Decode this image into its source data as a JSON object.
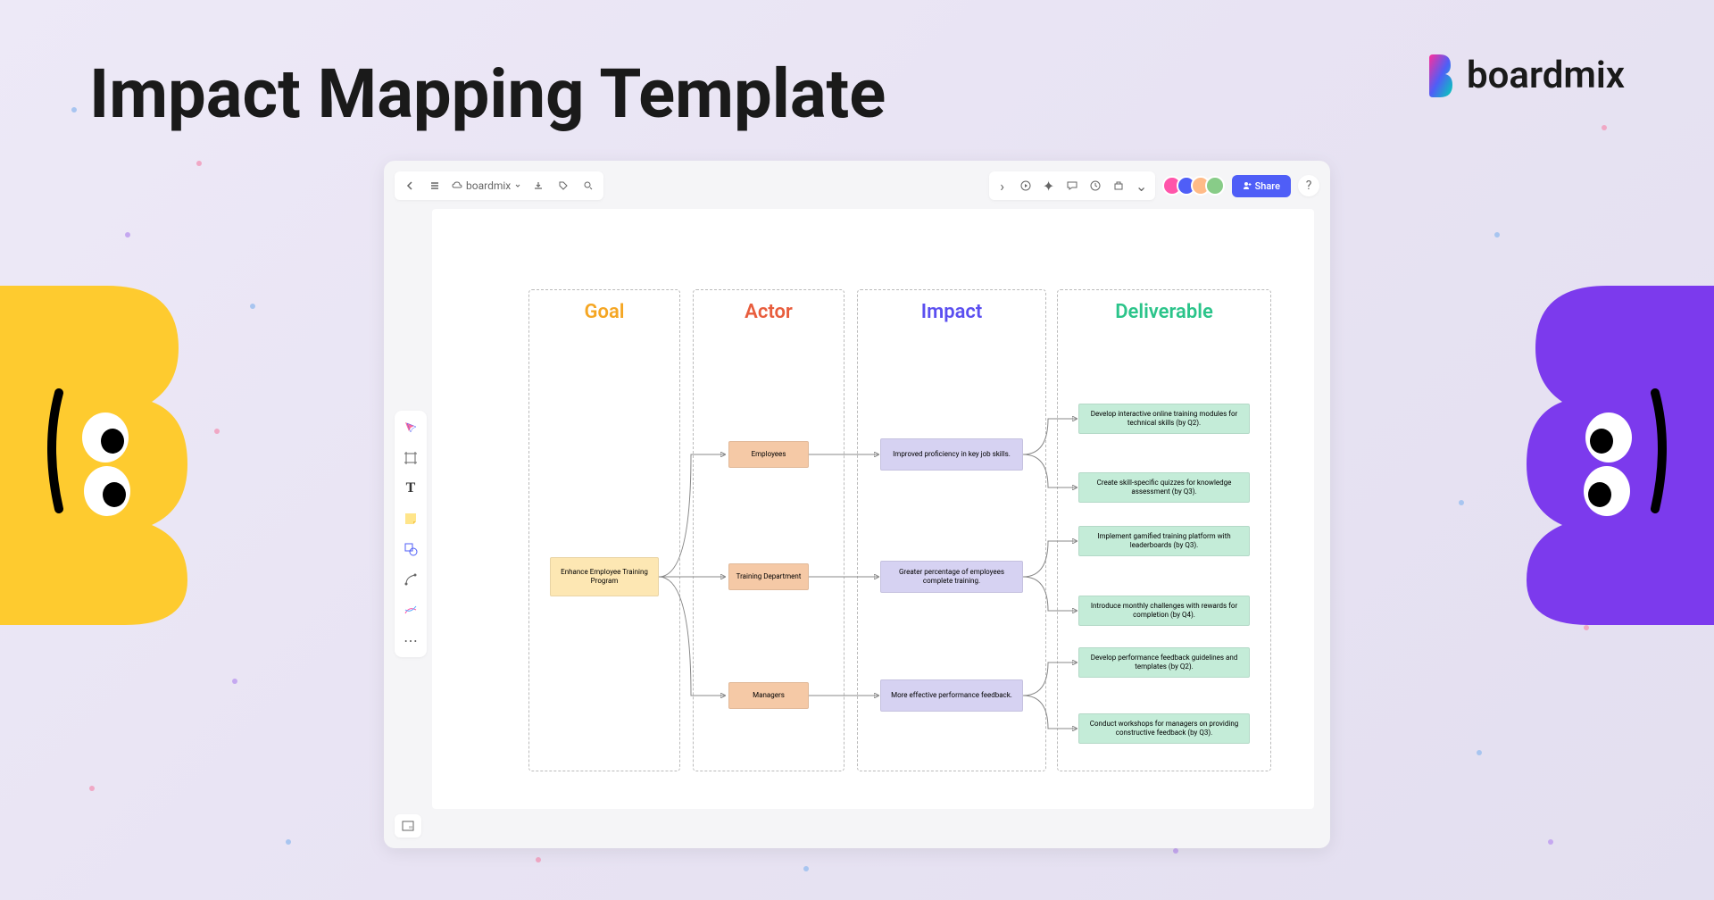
{
  "hero": {
    "title": "Impact Mapping Template"
  },
  "brand": {
    "name": "boardmix"
  },
  "app": {
    "toolbar": {
      "file_name": "boardmix",
      "share_label": "Share"
    },
    "columns": {
      "goal": "Goal",
      "actor": "Actor",
      "impact": "Impact",
      "deliverable": "Deliverable"
    },
    "nodes": {
      "goal": "Enhance Employee Training Program",
      "actors": [
        "Employees",
        "Training Department",
        "Managers"
      ],
      "impacts": [
        "Improved proficiency in key job skills.",
        "Greater percentage of employees complete training.",
        "More effective performance feedback."
      ],
      "deliverables": [
        "Develop interactive online training modules for technical skills (by Q2).",
        "Create skill-specific quizzes for knowledge assessment (by Q3).",
        "Implement gamified training platform with leaderboards (by Q3).",
        "Introduce monthly challenges with rewards for completion (by Q4).",
        "Develop performance feedback guidelines and templates (by Q2).",
        "Conduct workshops for managers on providing constructive feedback (by Q3)."
      ]
    }
  }
}
